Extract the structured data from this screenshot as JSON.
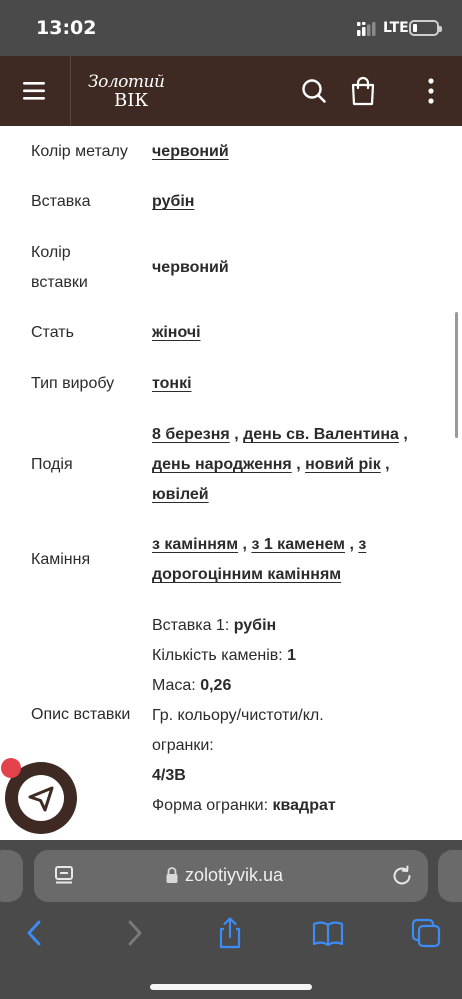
{
  "status_bar": {
    "time": "13:02",
    "network": "LTE",
    "battery_level": 0.2
  },
  "header": {
    "logo_line1": "Золотий",
    "logo_line2": "ВІК",
    "brand_color": "#3e2a22"
  },
  "attributes": [
    {
      "label": "Колір металу",
      "values": [
        {
          "text": "червоний",
          "link": true
        }
      ]
    },
    {
      "label": "Вставка",
      "values": [
        {
          "text": "рубін",
          "link": true
        }
      ]
    },
    {
      "label_lines": [
        "Колір",
        "вставки"
      ],
      "values": [
        {
          "text": "червоний",
          "link": false
        }
      ]
    },
    {
      "label": "Стать",
      "values": [
        {
          "text": "жіночі",
          "link": true
        }
      ]
    },
    {
      "label": "Тип виробу",
      "values": [
        {
          "text": "тонкі",
          "link": true
        }
      ]
    },
    {
      "label": "Подія",
      "values": [
        {
          "text": "8 березня",
          "link": true
        },
        {
          "text": "день св. Валентина",
          "link": true
        },
        {
          "text": "день народження",
          "link": true
        },
        {
          "text": "новий рік",
          "link": true
        },
        {
          "text": "ювілей",
          "link": true
        }
      ]
    },
    {
      "label": "Каміння",
      "values": [
        {
          "text": "з камінням",
          "link": true
        },
        {
          "text": "з 1 каменем",
          "link": true
        },
        {
          "text": "з дорогоцінним камінням",
          "link": true
        }
      ]
    }
  ],
  "insert_description": {
    "label": "Опис вставки",
    "lines": [
      {
        "key": "Вставка 1:",
        "value": "рубін"
      },
      {
        "key": "Кількість каменів:",
        "value": "1"
      },
      {
        "key": "Маса:",
        "value": "0,26"
      },
      {
        "key": "Гр. кольору/чистоти/кл.",
        "value": ""
      },
      {
        "key": "огранки:",
        "value": ""
      },
      {
        "key": "",
        "value": "4/3В"
      },
      {
        "key": "Форма огранки:",
        "value": "квадрат"
      }
    ]
  },
  "browser": {
    "url": "zolotiyvik.ua",
    "toolbar": [
      "back-icon",
      "forward-icon",
      "share-icon",
      "bookmarks-icon",
      "tabs-icon"
    ]
  },
  "colors": {
    "accent": "#3e2a22",
    "browser_chrome": "#4a4a4a",
    "link_blue": "#3d8bf5",
    "notification": "#e4424a"
  }
}
